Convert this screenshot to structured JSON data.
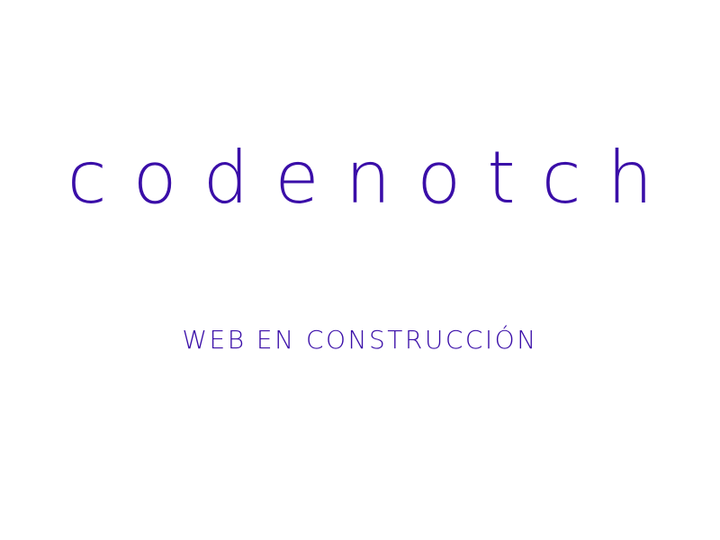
{
  "brand": {
    "name": "codenotch"
  },
  "status": {
    "message": "WEB EN CONSTRUCCIÓN"
  },
  "colors": {
    "accent": "#3a0ea8",
    "background": "#ffffff"
  }
}
